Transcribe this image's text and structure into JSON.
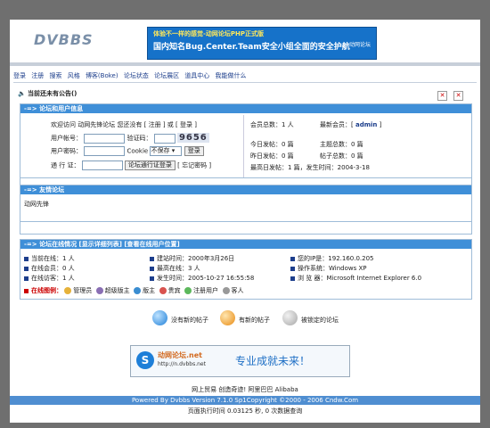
{
  "logo": "DVBBS",
  "top_banner": {
    "line1": "体验不一样的感觉-动网论坛PHP正式版",
    "line2": "国内知名Bug.Center.Team安全小组全面的安全护航",
    "badge": "动网论坛"
  },
  "nav": [
    "登录",
    "注册",
    "搜索",
    "风格",
    "博客(Boke)",
    "论坛状态",
    "论坛展区",
    "道具中心",
    "我能做什么"
  ],
  "announcement": "当前还未有公告()",
  "login_panel": {
    "title": "-=> 论坛和用户信息",
    "welcome": "欢迎访问 动网先锋论坛 您还没有 [ 注册 ] 或 [ 登录 ]",
    "username_label": "用户帐号：",
    "verify_label": "验证码：",
    "captcha": "9656",
    "password_label": "用户密码：",
    "cookie_label": "Cookie",
    "cookie_option": "不保存",
    "login_button": "登录",
    "pass_label": "通 行 证：",
    "pass_button": "论坛通行证登录",
    "forgot": "[ 忘记密码 ]",
    "stats": {
      "members": "会员总数：1 人",
      "newest_label": "最新会员：[",
      "newest": "admin",
      "newest_end": "]",
      "today_posts": "今日发帖：0 篇",
      "topics": "主题总数：0 篇",
      "yesterday": "昨日发帖：0 篇",
      "posts": "帖子总数：0 篇",
      "max_posts": "最高日发帖：1 篇，发生时间：2004-3-18"
    }
  },
  "friend_panel": {
    "title": "-=> 友情论坛",
    "item": "动网先锋"
  },
  "online_panel": {
    "title": "-=> 论坛在线情况 [显示详细列表] [查看在线用户位置]",
    "current": "当前在线：1 人",
    "members": "在线会员：0 人",
    "guests": "在线访客：1 人",
    "legend_label": "在线图例：",
    "legend": [
      "管理员",
      "超级版主",
      "版主",
      "贵宾",
      "注册用户",
      "客人"
    ],
    "build": "建站时间：2000年3月26日",
    "max": "最高在线：3 人",
    "occur": "发生时间：2005-10-27 16:55:58",
    "ip": "您的IP是：192.160.0.205",
    "os": "操作系统：Windows XP",
    "browser": "浏 览 器：Microsoft Internet Explorer 6.0"
  },
  "status_legend": [
    "没有新的帖子",
    "有新的帖子",
    "被锁定的论坛"
  ],
  "bottom_banner": {
    "site": "动网论坛.net",
    "url": "http://n.dvbbs.net",
    "slogan": "专业成就未来！",
    "sub": "创造奇迹!"
  },
  "footer": {
    "line1": "网上贸易 创造奇迹! 阿里巴巴 Alibaba",
    "line2": "Powered By Dvbbs Version 7.1.0 Sp1Copyright ©2000 - 2006 Cndw.Com",
    "line3": "页面执行时间 0.03125 秒, 0 次数据查询"
  },
  "colors": {
    "panel_head": "#3f8fd8",
    "accent_red": "#cc0000",
    "link": "#1b3d8b"
  }
}
